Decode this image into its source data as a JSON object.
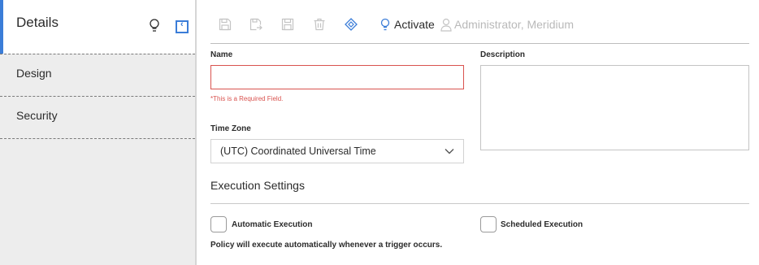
{
  "sidebar": {
    "header": {
      "title": "Details"
    },
    "items": [
      {
        "label": "Design"
      },
      {
        "label": "Security"
      }
    ]
  },
  "toolbar": {
    "activate_label": "Activate",
    "user_label": "Administrator, Meridium"
  },
  "form": {
    "name": {
      "label": "Name",
      "value": "",
      "error": "*This is a Required Field."
    },
    "description": {
      "label": "Description",
      "value": ""
    },
    "time_zone": {
      "label": "Time Zone",
      "value": "(UTC) Coordinated Universal Time"
    }
  },
  "execution": {
    "title": "Execution Settings",
    "automatic_label": "Automatic Execution",
    "scheduled_label": "Scheduled Execution",
    "help_text": "Policy will execute automatically whenever a trigger occurs."
  },
  "colors": {
    "accent": "#3b7dd8",
    "error": "#d9534f",
    "disabled_icon": "#c4c4c4"
  }
}
